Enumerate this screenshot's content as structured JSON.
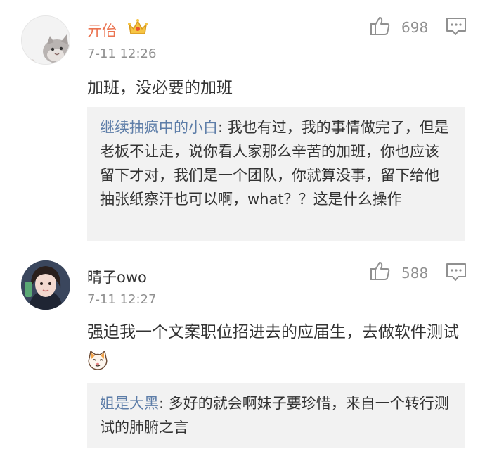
{
  "comments": [
    {
      "user": "亓佁",
      "time": "7-11 12:26",
      "likes": "698",
      "text": "加班，没必要的加班",
      "quote_user": "继续抽疯中的小白",
      "quote_text": ": 我也有过，我的事情做完了，但是老板不让走，说你看人家那么辛苦的加班，你也应该留下才对，我们是一个团队，你就算没事，留下给他抽张纸察汗也可以啊，what？？这是什么操作",
      "badge_icon": "crown-icon",
      "name_color": "#eb7350"
    },
    {
      "user": "晴子owo",
      "time": "7-11 12:27",
      "likes": "588",
      "text": "强迫我一个文案职位招进去的应届生，去做软件测试",
      "emoji_icon": "cat-face-emoji",
      "quote_user": "姐是大黑",
      "quote_text": ": 多好的就会啊妹子要珍惜，来自一个转行测试的肺腑之言"
    }
  ],
  "colors": {
    "link": "#5d7da8",
    "meta": "#909090",
    "quote_bg": "#f2f2f2",
    "text": "#333333"
  },
  "icons": {
    "like": "thumbs-up-icon",
    "reply": "comment-bubble-icon"
  }
}
